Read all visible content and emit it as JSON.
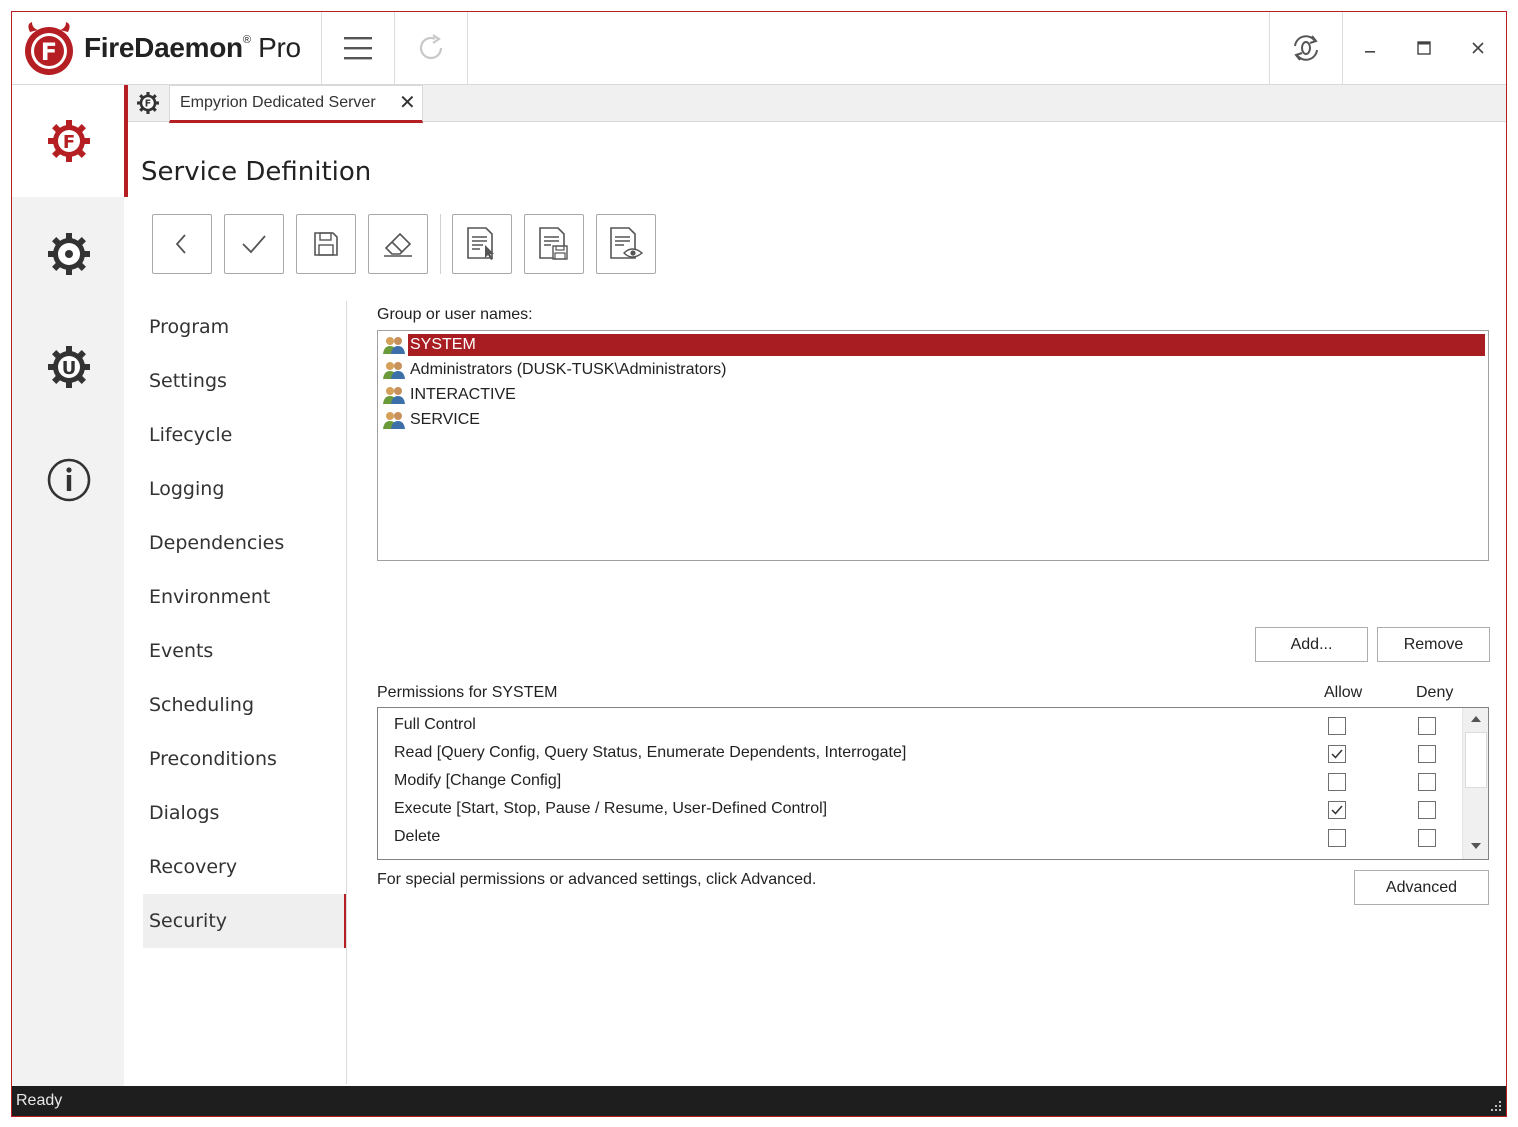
{
  "app": {
    "brand_name": "FireDaemon",
    "brand_reg": "®",
    "brand_edition": "Pro"
  },
  "tabs": {
    "active_label": "Empyrion Dedicated Server",
    "close_glyph": "✕"
  },
  "page": {
    "title": "Service Definition"
  },
  "toolbar": {
    "icons": [
      "back-icon",
      "apply-check-icon",
      "save-icon",
      "eraser-icon",
      "import-definition-icon",
      "export-definition-icon",
      "preview-definition-icon"
    ]
  },
  "nav": {
    "items": [
      "Program",
      "Settings",
      "Lifecycle",
      "Logging",
      "Dependencies",
      "Environment",
      "Events",
      "Scheduling",
      "Preconditions",
      "Dialogs",
      "Recovery",
      "Security"
    ],
    "active": "Security"
  },
  "security": {
    "group_label": "Group or user names:",
    "users": [
      {
        "name": "SYSTEM",
        "selected": true
      },
      {
        "name": "Administrators (DUSK-TUSK\\Administrators)",
        "selected": false
      },
      {
        "name": "INTERACTIVE",
        "selected": false
      },
      {
        "name": "SERVICE",
        "selected": false
      }
    ],
    "add_label": "Add...",
    "remove_label": "Remove",
    "permissions_label": "Permissions for SYSTEM",
    "allow_header": "Allow",
    "deny_header": "Deny",
    "permissions": [
      {
        "name": "Full Control",
        "allow": false,
        "deny": false
      },
      {
        "name": "Read [Query Config, Query Status, Enumerate Dependents, Interrogate]",
        "allow": true,
        "deny": false
      },
      {
        "name": "Modify [Change Config]",
        "allow": false,
        "deny": false
      },
      {
        "name": "Execute [Start, Stop, Pause / Resume, User-Defined Control]",
        "allow": true,
        "deny": false
      },
      {
        "name": "Delete",
        "allow": false,
        "deny": false
      }
    ],
    "advanced_hint": "For special permissions or advanced settings, click Advanced.",
    "advanced_label": "Advanced"
  },
  "status": {
    "text": "Ready"
  },
  "colors": {
    "accent": "#b51f23",
    "selection": "#a81d22",
    "statusbar": "#1e1e1e"
  }
}
